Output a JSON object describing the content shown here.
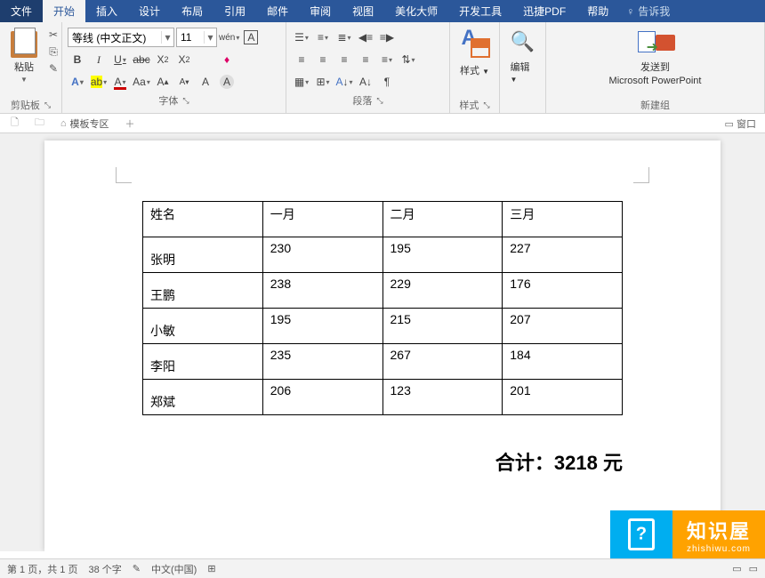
{
  "tabs": {
    "file": "文件",
    "home": "开始",
    "insert": "插入",
    "design": "设计",
    "layout": "布局",
    "references": "引用",
    "mail": "邮件",
    "review": "审阅",
    "view": "视图",
    "beautify": "美化大师",
    "dev": "开发工具",
    "xunjie": "迅捷PDF",
    "help": "帮助",
    "tellme": "告诉我"
  },
  "ribbon": {
    "clipboard": {
      "paste": "粘贴",
      "label": "剪贴板"
    },
    "font": {
      "name": "等线 (中文正文)",
      "size": "11",
      "label": "字体"
    },
    "paragraph": {
      "label": "段落"
    },
    "styles": {
      "btn": "样式",
      "label": "样式"
    },
    "edit": {
      "btn": "编辑"
    },
    "send": {
      "btn": "发送到",
      "target": "Microsoft PowerPoint",
      "label": "新建组"
    }
  },
  "docTabs": {
    "template": "模板专区",
    "windows": "窗口"
  },
  "table": {
    "headers": [
      "姓名",
      "一月",
      "二月",
      "三月"
    ],
    "rows": [
      {
        "name": "张明",
        "v": [
          "230",
          "195",
          "227"
        ]
      },
      {
        "name": "王鹏",
        "v": [
          "238",
          "229",
          "176"
        ]
      },
      {
        "name": "小敏",
        "v": [
          "195",
          "215",
          "207"
        ]
      },
      {
        "name": "李阳",
        "v": [
          "235",
          "267",
          "184"
        ]
      },
      {
        "name": "郑斌",
        "v": [
          "206",
          "123",
          "201"
        ]
      }
    ]
  },
  "total": {
    "label": "合计：",
    "value": "3218",
    "unit": " 元"
  },
  "status": {
    "page": "第 1 页，共 1 页",
    "words": "38 个字",
    "lang": "中文(中国)"
  },
  "watermark": {
    "title": "知识屋",
    "url": "zhishiwu.com"
  }
}
